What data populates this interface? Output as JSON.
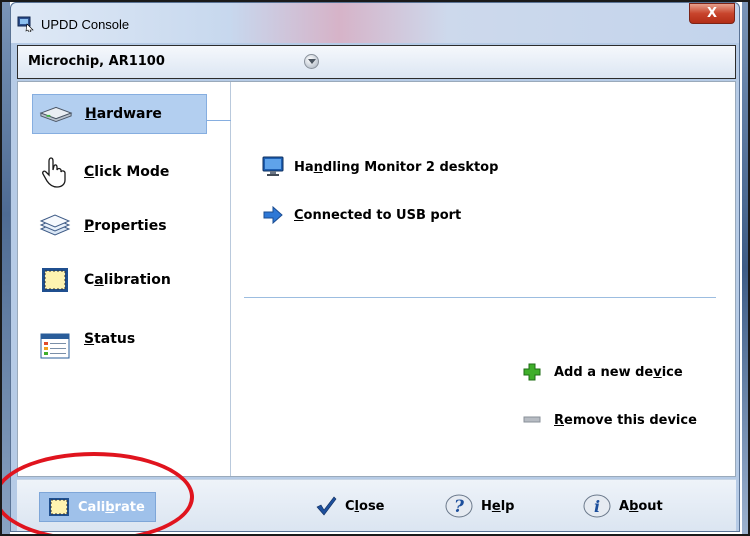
{
  "window": {
    "title": "UPDD Console",
    "close_label": "X"
  },
  "device": {
    "name": "Microchip, AR1100"
  },
  "nav": {
    "items": [
      {
        "pre": "",
        "ul": "H",
        "post": "ardware",
        "icon": "hardware-device-icon",
        "selected": true
      },
      {
        "pre": "",
        "ul": "C",
        "post": "lick Mode",
        "icon": "hand-pointer-icon"
      },
      {
        "pre": "",
        "ul": "P",
        "post": "roperties",
        "icon": "layers-icon"
      },
      {
        "pre": "C",
        "ul": "a",
        "post": "libration",
        "icon": "calibration-target-icon"
      },
      {
        "pre": "",
        "ul": "S",
        "post": "tatus",
        "icon": "status-list-icon"
      }
    ]
  },
  "info": {
    "monitor": {
      "pre": "Ha",
      "ul": "n",
      "post": "dling Monitor 2 desktop",
      "icon": "monitor-icon"
    },
    "port": {
      "pre": "",
      "ul": "C",
      "post": "onnected to USB port",
      "icon": "arrow-right-icon"
    }
  },
  "actions": {
    "add": {
      "pre": "Add a new de",
      "ul": "v",
      "post": "ice",
      "icon": "plus-icon"
    },
    "remove": {
      "pre": "",
      "ul": "R",
      "post": "emove this device",
      "icon": "minus-icon"
    }
  },
  "bottom": {
    "calibrate": {
      "pre": "Cali",
      "ul": "b",
      "post": "rate",
      "icon": "calibration-target-icon"
    },
    "close": {
      "pre": "C",
      "ul": "l",
      "post": "ose",
      "icon": "checkmark-icon"
    },
    "help": {
      "pre": "H",
      "ul": "e",
      "post": "lp",
      "icon": "help-icon"
    },
    "about": {
      "pre": "A",
      "ul": "b",
      "post": "out",
      "icon": "info-icon"
    }
  },
  "colors": {
    "selected_bg": "#b3cff0",
    "highlight_annotation": "#e0141e",
    "plus_green": "#3fae2a",
    "arrow_blue": "#2e78d6"
  }
}
